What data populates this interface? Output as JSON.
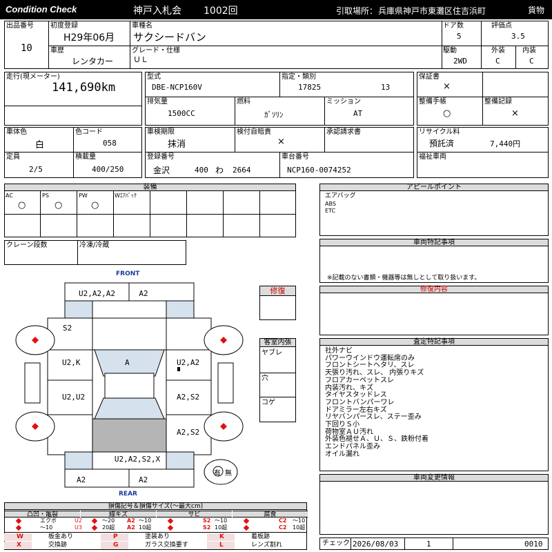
{
  "header": {
    "title": "Condition Check",
    "auction": "神戸入札会",
    "number": "1002回",
    "pickup_label": "引取場所：",
    "pickup": "兵庫県神戸市東灘区住吉浜町",
    "category": "貨物"
  },
  "r1": {
    "lot_label": "出品番号",
    "lot": "10",
    "first_reg_label": "初度登録",
    "first_reg": "H29年06月",
    "car_name_label": "車種名",
    "car_name": "サクシードバン",
    "doors_label": "ドア数",
    "doors": "5",
    "score_label": "評価点",
    "score": "3.5",
    "history_label": "車歴",
    "history": "レンタカー",
    "grade_label": "グレード・仕様",
    "grade": "ＵＬ",
    "drive_label": "駆動",
    "drive": "2WD",
    "exterior_label": "外装",
    "exterior": "C",
    "interior_label": "内装",
    "interior": "C"
  },
  "r2": {
    "mileage_label": "走行(現メーター)",
    "mileage": "141,690km",
    "model_label": "型式",
    "model": "DBE-NCP160V",
    "designation_label": "指定・類別",
    "designation": "17825",
    "category_no": "13",
    "warranty_label": "保証書",
    "warranty": "×",
    "displacement_label": "排気量",
    "displacement": "1500CC",
    "fuel_label": "燃料",
    "fuel": "ｶﾞｿﾘﾝ",
    "transmission_label": "ミッション",
    "transmission": "AT",
    "service_book_label": "整備手帳",
    "service_book": "○",
    "service_record_label": "整備記録",
    "service_record": "×"
  },
  "r3": {
    "body_color_label": "車体色",
    "body_color": "白",
    "color_code_label": "色コード",
    "color_code": "058",
    "inspection_label": "車検期限",
    "inspection": "抹消",
    "cert_label": "検付自賠責",
    "cert": "×",
    "approval_label": "承認請求書",
    "recycle_label": "リサイクル料",
    "recycle_status": "預託済",
    "recycle_fee": "7,440円",
    "capacity_label": "定員",
    "capacity": "2/5",
    "load_label": "積載量",
    "load": "400/250",
    "reg_no_label": "登録番号",
    "reg_area": "金沢",
    "reg_class": "400",
    "reg_kana": "わ",
    "reg_num": "2664",
    "chassis_label": "車台番号",
    "chassis": "NCP160-0074252",
    "welfare_label": "福祉車両"
  },
  "equipment": {
    "title": "装備",
    "items": [
      {
        "label": "AC",
        "val": "○"
      },
      {
        "label": "PS",
        "val": "○"
      },
      {
        "label": "PW",
        "val": "○"
      },
      {
        "label": "Wｴｱﾊﾞｯｸ",
        "val": ""
      }
    ],
    "crane_label": "クレーン段数",
    "freezer_label": "冷凍/冷蔵"
  },
  "appeal": {
    "title": "アピールポイント",
    "lines": [
      "エアバッグ",
      "ABS",
      "ETC"
    ]
  },
  "special": {
    "title": "車両特記事項",
    "note": "※記載のない書類・機器等は無しとして取り扱います。"
  },
  "repair_content": {
    "title": "修復内容"
  },
  "assessment": {
    "title": "査定特記事項",
    "lines": [
      "社外ナビ",
      "パワーウインドウ運転席のみ",
      "フロントシートヘタリ、スレ",
      "天張り汚れ、スレ、 内張りキズ",
      "フロアカーペットスレ",
      "内装汚れ、キズ",
      "タイヤスタッドレス",
      "フロントバンパーワレ",
      "ドアミラー左右キズ",
      "リヤバンパースレ、ステー歪み",
      "下回りＳ小",
      "荷物室ＡＵ汚れ",
      "外装色褪せＡ、Ｕ、Ｓ、鉄粉付着",
      "エンドパネル歪み",
      "オイル漏れ"
    ]
  },
  "change": {
    "title": "車両変更情報"
  },
  "diagram": {
    "front": "FRONT",
    "rear": "REAR",
    "repair": "修復",
    "cabin": "客室内張",
    "cabin_items": [
      "ヤブレ",
      "穴",
      "コゲ"
    ],
    "marks": {
      "front_left": "U2,A2,A2",
      "front_right": "A2",
      "left1": "S2",
      "left2": "U2,K",
      "left3": "U2,U2",
      "center": "A",
      "right2": "U2,A2",
      "right3": "A2,S2",
      "right4": "A2,S2",
      "rear_center": "U2,A2,S2,X",
      "rear_left": "A2",
      "rear_right": "A2"
    },
    "spare": "有",
    "spare_none": "無"
  },
  "legend": {
    "title": "損傷記号＆損傷サイズ(〜最大cm)",
    "groups": [
      "凸凹・亀裂",
      "線キズ",
      "サビ",
      "腐食"
    ],
    "rows": [
      [
        "エクボ",
        "U2",
        "〜20",
        "A2",
        "〜10",
        "S2",
        "〜10",
        "C2",
        "〜10"
      ],
      [
        "〜10",
        "U3",
        "20超",
        "A2",
        "10超",
        "S2",
        "10超",
        "C2",
        "10超"
      ]
    ],
    "codes": [
      [
        "W",
        "板金あり",
        "P",
        "塗装あり",
        "K",
        "着板跡"
      ],
      [
        "X",
        "交換跡",
        "G",
        "ガラス交換要す",
        "L",
        "レンズ割れ"
      ]
    ]
  },
  "check": {
    "label": "チェック",
    "date": "2026/08/03",
    "num": "1",
    "code": "0010"
  }
}
